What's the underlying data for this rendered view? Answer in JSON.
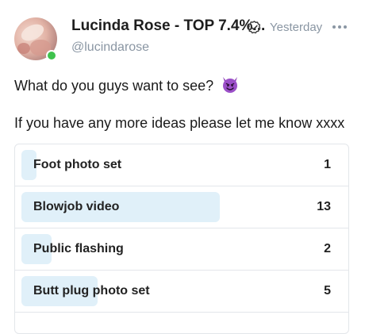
{
  "post": {
    "author_name": "Lucinda Rose - TOP 7.4%...",
    "handle": "@lucindarose",
    "timestamp": "Yesterday",
    "verified_icon": "verified-check-icon",
    "more_icon": "more-dots-icon",
    "online": true,
    "line1": "What do you guys want to see?",
    "line1_emoji": "smiling-devil-emoji",
    "line2": "If you have any more ideas please let me know xxxx"
  },
  "poll": {
    "bar_color": "#e0f0f9",
    "options": [
      {
        "label": "Foot photo set",
        "votes": "1",
        "share": 0.048
      },
      {
        "label": "Blowjob video",
        "votes": "13",
        "share": 0.619
      },
      {
        "label": "Public flashing",
        "votes": "2",
        "share": 0.095
      },
      {
        "label": "Butt plug photo set",
        "votes": "5",
        "share": 0.238
      }
    ]
  }
}
